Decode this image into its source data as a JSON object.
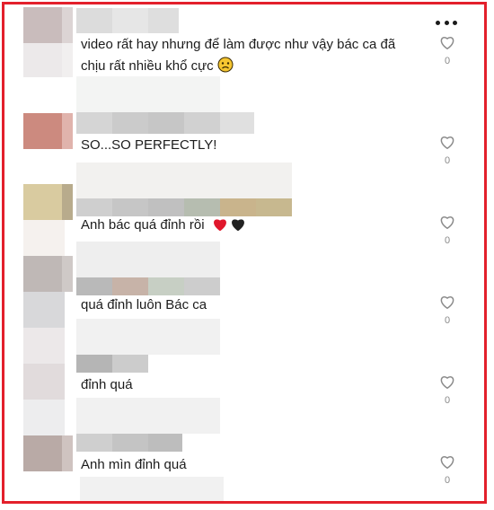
{
  "comments": [
    {
      "text": "video rất hay nhưng để làm được như vậy bác ca đã",
      "text2": "chịu rất nhiều khổ cực",
      "emoji": "worried-face-emoji",
      "likes": "0"
    },
    {
      "text": "SO...SO PERFECTLY!",
      "likes": "0"
    },
    {
      "text": "Anh bác quá đỉnh rồi",
      "emoji": "hearts-red-black",
      "likes": "0"
    },
    {
      "text": "quá đỉnh luôn Bác ca",
      "likes": "0"
    },
    {
      "text": "đỉnh quá",
      "likes": "0"
    },
    {
      "text": "Anh mìn đỉnh quá",
      "likes": "0"
    }
  ],
  "icons": {
    "more": "more-dots-icon",
    "like": "heart-outline-icon"
  },
  "colors": {
    "frame": "#e3202b",
    "text": "#1c1c1c",
    "count": "#8a8a8a"
  }
}
